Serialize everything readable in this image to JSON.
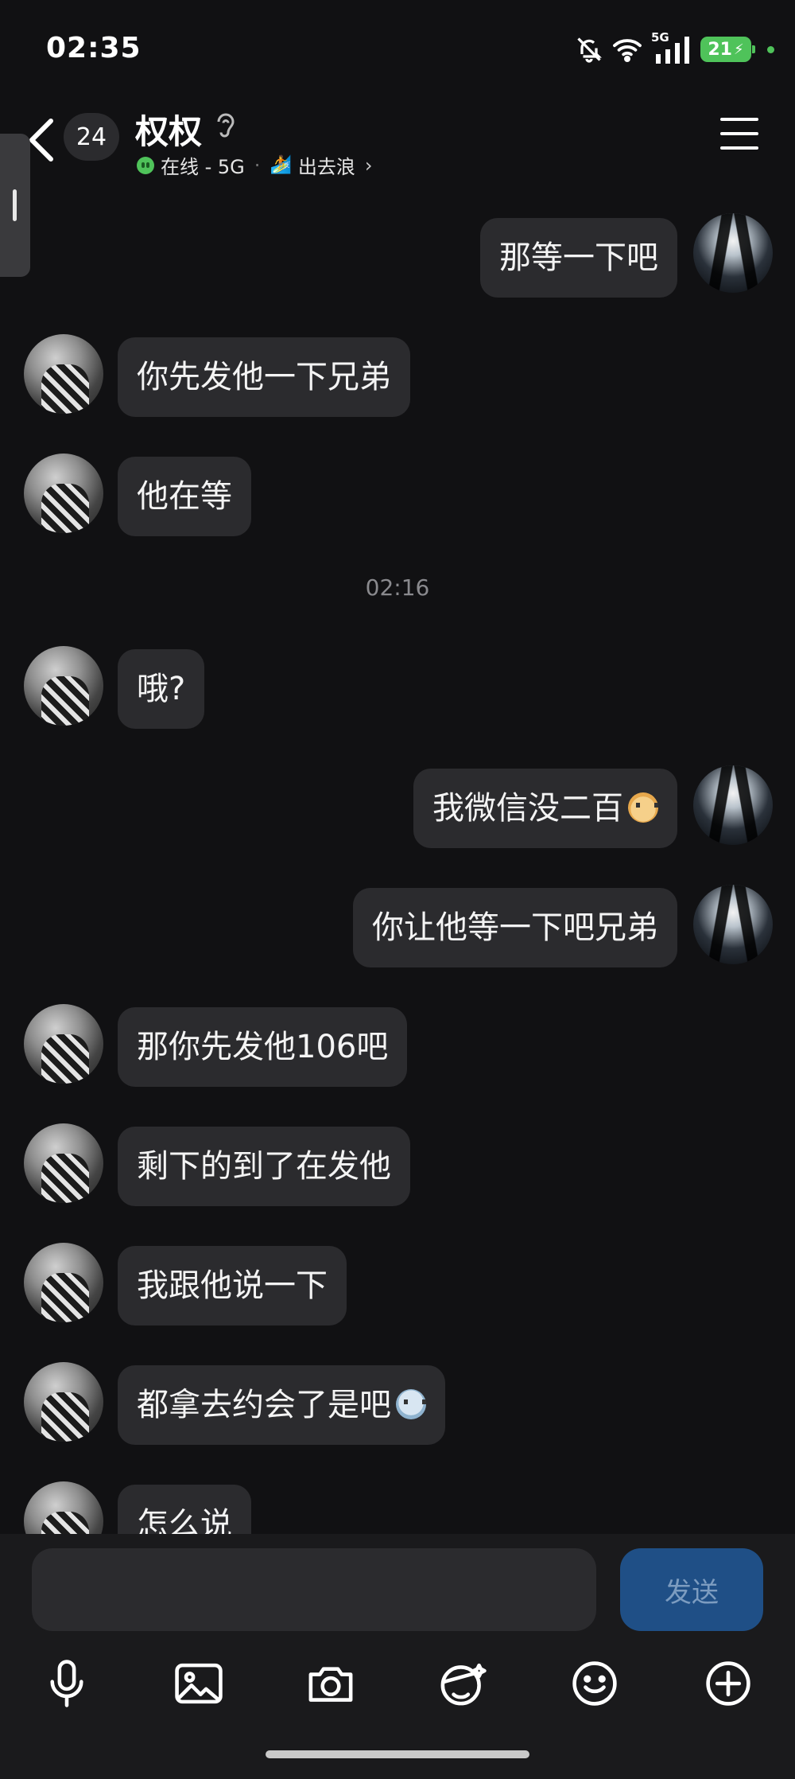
{
  "status_bar": {
    "time": "02:35",
    "network": "5G",
    "battery_level": "21"
  },
  "header": {
    "unread_count": "24",
    "contact_name": "权权",
    "online_status": "在线 - 5G",
    "activity": "出去浪"
  },
  "messages": [
    {
      "side": "self",
      "text": "那等一下吧"
    },
    {
      "side": "other",
      "text": "你先发他一下兄弟"
    },
    {
      "side": "other",
      "text": "他在等"
    },
    {
      "side": "other",
      "text": "哦?"
    },
    {
      "side": "self",
      "text": "我微信没二百",
      "emoji": "bear-emoji"
    },
    {
      "side": "self",
      "text": "你让他等一下吧兄弟"
    },
    {
      "side": "other",
      "text": "那你先发他106吧"
    },
    {
      "side": "other",
      "text": "剩下的到了在发他"
    },
    {
      "side": "other",
      "text": "我跟他说一下"
    },
    {
      "side": "other",
      "text": "都拿去约会了是吧",
      "emoji": "scared-emoji"
    },
    {
      "side": "other",
      "text": "怎么说"
    }
  ],
  "timestamp": "02:16",
  "input": {
    "value": "",
    "send_label": "发送"
  },
  "toolbar_icons": [
    "microphone-icon",
    "image-icon",
    "camera-icon",
    "sticker-icon",
    "emoji-icon",
    "plus-icon"
  ],
  "colors": {
    "background": "#111113",
    "bubble": "#2b2b2e",
    "send_button": "#1f4f86",
    "online": "#4fc35a"
  }
}
